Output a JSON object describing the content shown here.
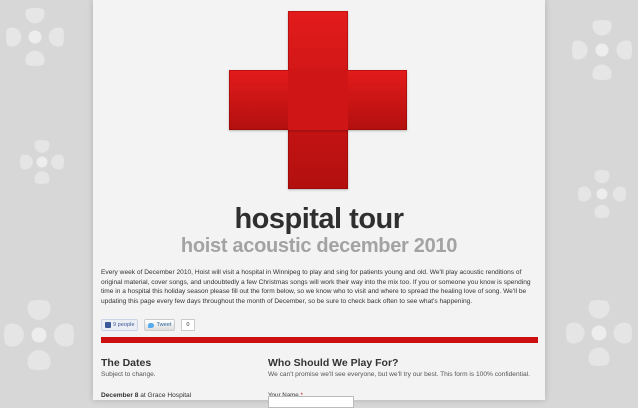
{
  "header": {
    "title": "hospital tour",
    "subtitle": "hoist acoustic december 2010"
  },
  "intro": {
    "text": "Every week of December 2010, Hoist will visit a hospital in Winnipeg to play and sing for patients young and old. We'll play acoustic renditions of original material, cover songs, and undoubtedly a few Christmas songs will work their way into the mix too. If you or someone you know is spending time in a hospital this holiday season please fill out the form below, so we know who to visit and where to spread the healing love of song. We'll be updating this page every few days throughout the month of December, so be sure to check back often to see what's happening."
  },
  "social": {
    "like_label": "9 people",
    "tweet_label": "Tweet",
    "tweet_count": "0"
  },
  "dates": {
    "heading": "The Dates",
    "note": "Subject to change.",
    "entries": [
      {
        "date": "December 8",
        "location": " at Grace Hospital"
      }
    ]
  },
  "form": {
    "heading": "Who Should We Play For?",
    "note": "We can't promise we'll see everyone, but we'll try our best. This form is 100% confidential.",
    "name_label": "Your Name",
    "required_mark": "*",
    "name_value": ""
  },
  "colors": {
    "accent_red": "#cc0f0f",
    "title_dark": "#2f2f2f",
    "subtitle_gray": "#a3a3a3",
    "page_bg": "#f3f3f3"
  }
}
